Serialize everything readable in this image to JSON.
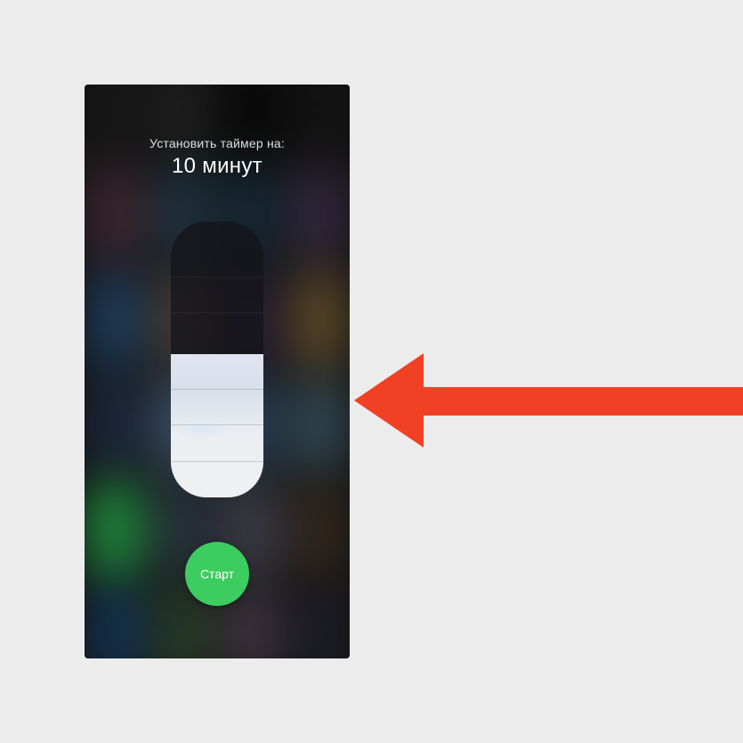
{
  "timer": {
    "title_label": "Установить таймер на:",
    "time_value": "10 минут",
    "slider_fill_percent": 52
  },
  "start_button": {
    "label": "Старт"
  },
  "colors": {
    "accent_green": "#3dcc60",
    "arrow_red": "#f14124"
  }
}
